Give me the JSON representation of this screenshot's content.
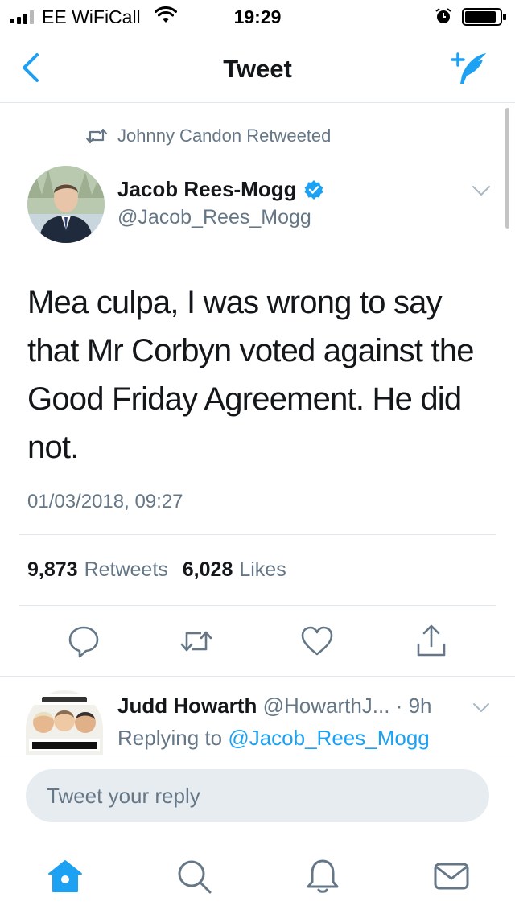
{
  "status_bar": {
    "carrier": "EE WiFiCall",
    "time": "19:29"
  },
  "nav": {
    "title": "Tweet",
    "back_icon": "chevron-left-icon",
    "compose_icon": "compose-quill-icon"
  },
  "retweet_header": {
    "text": "Johnny Candon Retweeted",
    "icon": "retweet-icon"
  },
  "tweet": {
    "author_name": "Jacob Rees-Mogg",
    "author_handle": "@Jacob_Rees_Mogg",
    "verified": true,
    "text": "Mea culpa, I was wrong to say that Mr Corbyn voted against the Good Friday Agreement. He did not.",
    "timestamp": "01/03/2018, 09:27",
    "retweets_count": "9,873",
    "retweets_label": "Retweets",
    "likes_count": "6,028",
    "likes_label": "Likes"
  },
  "actions": [
    {
      "name": "reply-icon"
    },
    {
      "name": "retweet-icon"
    },
    {
      "name": "like-heart-icon"
    },
    {
      "name": "share-icon"
    }
  ],
  "reply": {
    "author_name": "Judd Howarth",
    "meta": "@HowarthJ... · 9h",
    "replying_prefix": "Replying to",
    "replying_handle": "@Jacob_Rees_Mogg"
  },
  "composer": {
    "placeholder": "Tweet your reply"
  },
  "tab_bar": [
    {
      "name": "home-icon",
      "active": true
    },
    {
      "name": "search-icon",
      "active": false
    },
    {
      "name": "notifications-bell-icon",
      "active": false
    },
    {
      "name": "messages-envelope-icon",
      "active": false
    }
  ],
  "colors": {
    "accent": "#1da1f2",
    "secondary_text": "#657786",
    "primary_text": "#14171a",
    "divider": "#e1e8ed",
    "input_bg": "#e6ecf0"
  }
}
